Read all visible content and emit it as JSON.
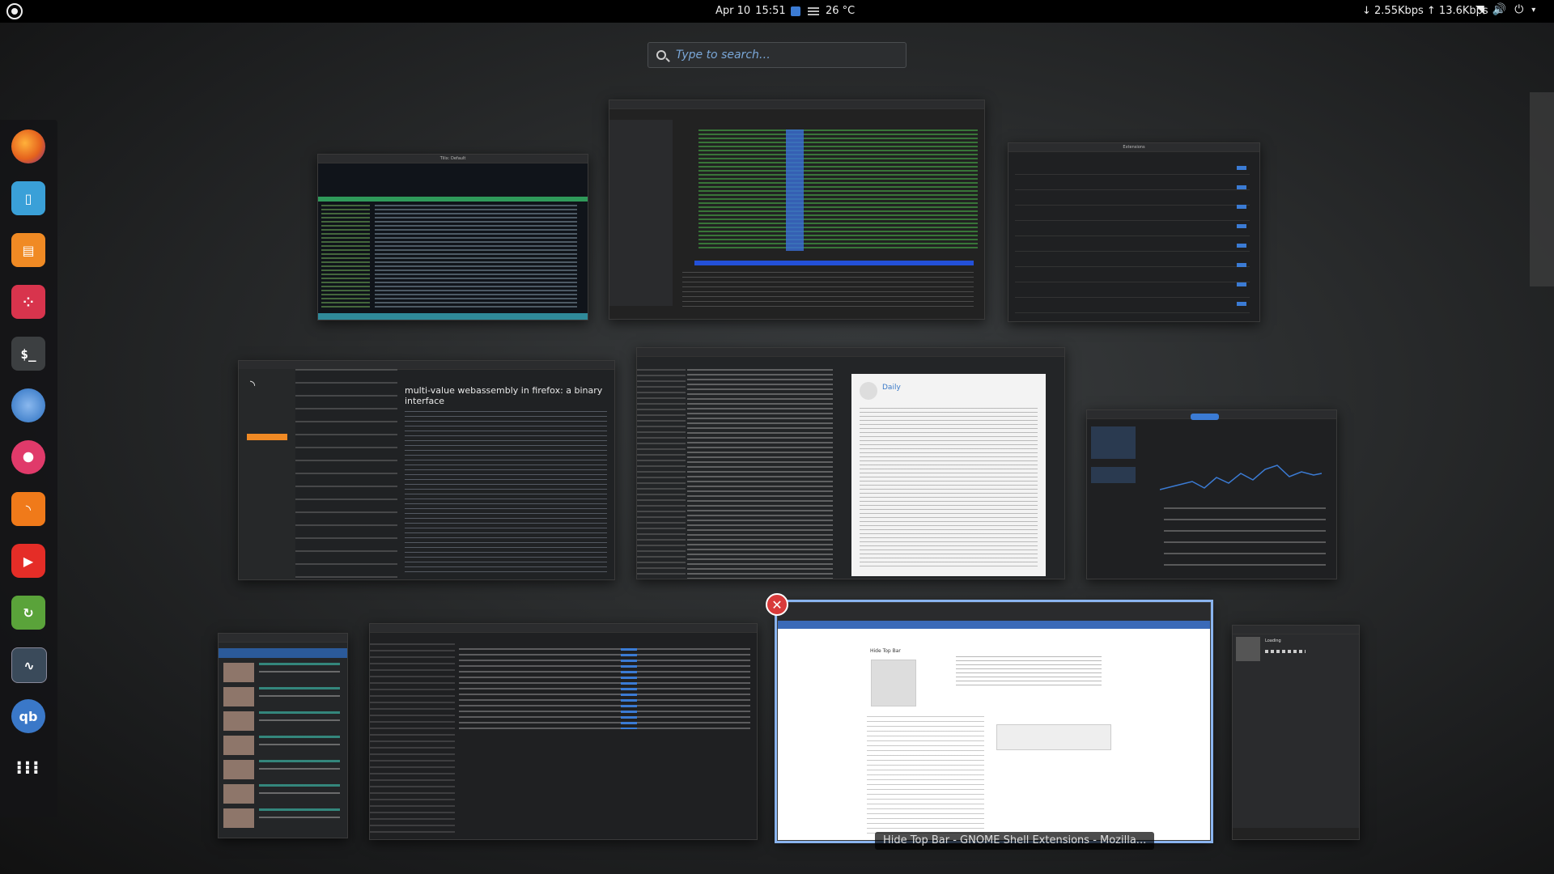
{
  "topbar": {
    "date": "Apr 10",
    "time": "15:51",
    "temperature": "26 °C",
    "netspeed": "↓ 2.55Kbps ↑ 13.6Kbps"
  },
  "search": {
    "placeholder": "Type to search…"
  },
  "dash": {
    "apps": [
      {
        "name": "firefox-icon",
        "color": "#e5621d"
      },
      {
        "name": "files-icon",
        "color": "#3aa0d8"
      },
      {
        "name": "store-icon",
        "color": "#f08a24"
      },
      {
        "name": "tiling-icon",
        "color": "#d8344d"
      },
      {
        "name": "terminal-icon",
        "color": "#3c3f41"
      },
      {
        "name": "thunderbird-icon",
        "color": "#2a6fc0"
      },
      {
        "name": "lollypop-icon",
        "color": "#e03a6a"
      },
      {
        "name": "rss-icon",
        "color": "#f07a1a"
      },
      {
        "name": "youtube-icon",
        "color": "#e52d27"
      },
      {
        "name": "update-icon",
        "color": "#5aa33a"
      },
      {
        "name": "monitor-icon",
        "color": "#3a4a5a"
      },
      {
        "name": "qbittorrent-icon",
        "color": "#3a78c8"
      },
      {
        "name": "app-grid-icon",
        "color": "transparent"
      }
    ]
  },
  "windows": {
    "terminal_title": "Tilix: Default",
    "article_title": "multi-value webassembly in firefox: a binary interface",
    "daily_title": "Daily",
    "extensions_title": "Extensions",
    "music_title": "Loading",
    "caption": "Hide Top Bar - GNOME Shell Extensions - Mozilla..."
  }
}
